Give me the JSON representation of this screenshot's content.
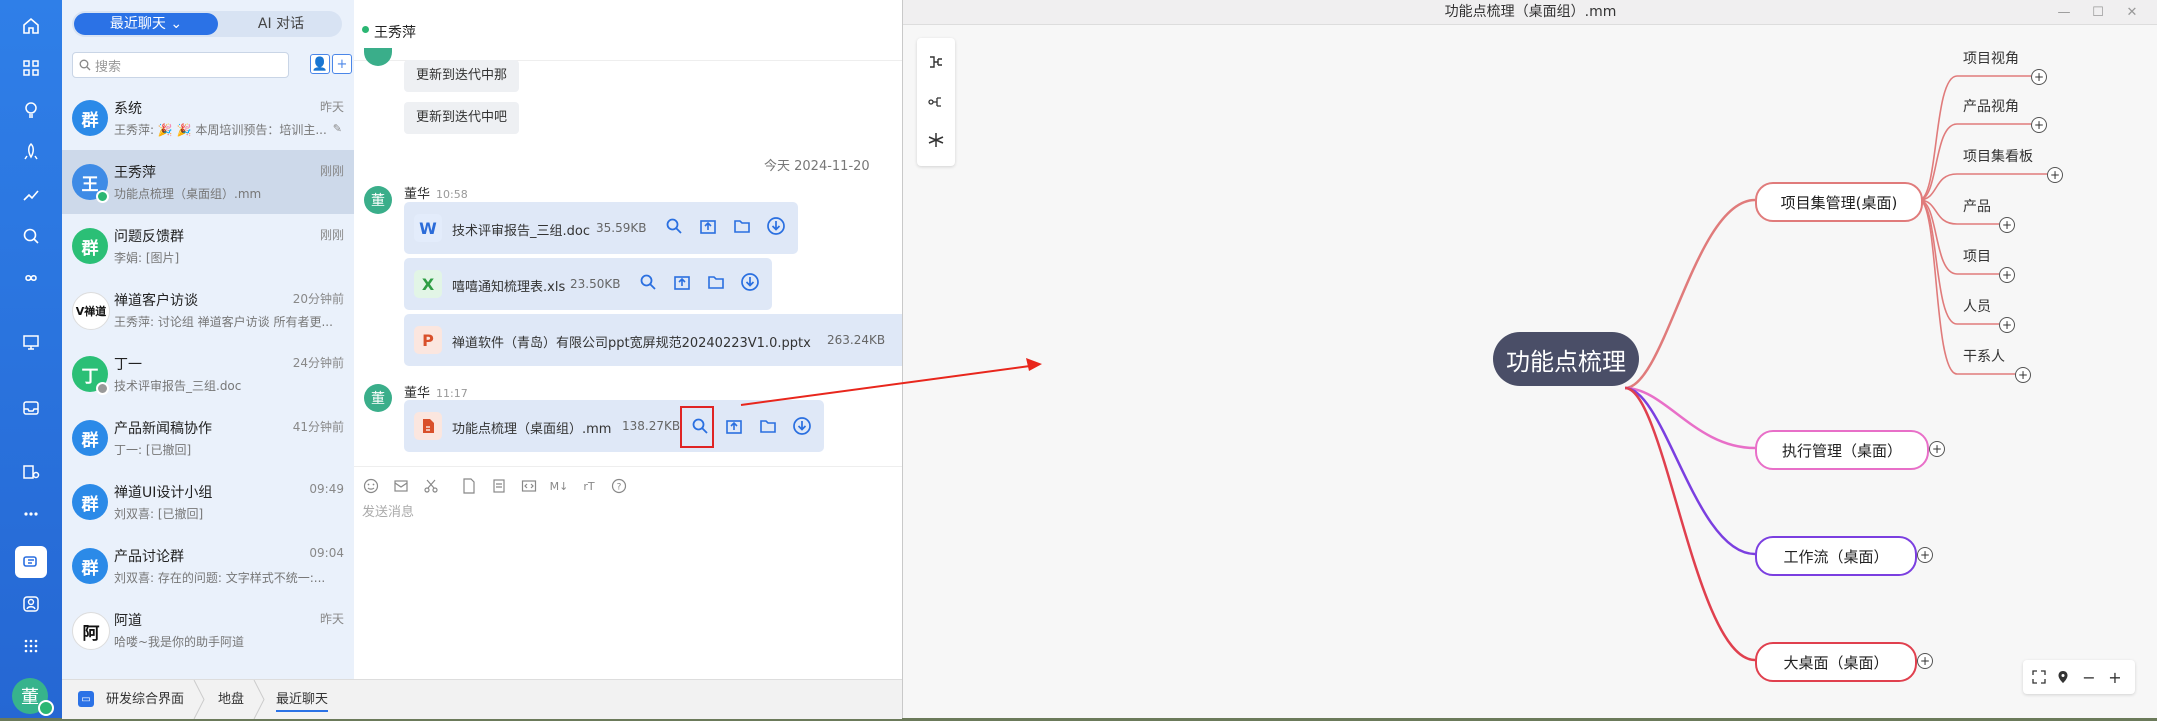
{
  "sidebar_tabs": {
    "recent": "最近聊天",
    "ai": "AI 对话"
  },
  "search": {
    "placeholder": "搜索"
  },
  "conversations": [
    {
      "avatar": "群",
      "name": "系统",
      "time": "昨天",
      "preview": "王秀萍: 🎉 🎉 本周培训预告：培训主...",
      "color": "#2b8ae8"
    },
    {
      "avatar": "王",
      "name": "王秀萍",
      "time": "刚刚",
      "preview": "功能点梳理（桌面组）.mm",
      "color": "#3e8be6"
    },
    {
      "avatar": "群",
      "name": "问题反馈群",
      "time": "刚刚",
      "preview": "李娟: [图片]",
      "color": "#2bbf76"
    },
    {
      "avatar": "V禅道",
      "name": "禅道客户访谈",
      "time": "20分钟前",
      "preview": "王秀萍: 讨论组 禅道客户访谈 所有者更...",
      "color": "#ffffff"
    },
    {
      "avatar": "丁",
      "name": "丁一",
      "time": "24分钟前",
      "preview": "技术评审报告_三组.doc",
      "color": "#2bbf76"
    },
    {
      "avatar": "群",
      "name": "产品新闻稿协作",
      "time": "41分钟前",
      "preview": "丁一: [已撤回]",
      "color": "#2b8ae8"
    },
    {
      "avatar": "群",
      "name": "禅道UI设计小组",
      "time": "09:49",
      "preview": "刘双喜: [已撤回]",
      "color": "#2b8ae8"
    },
    {
      "avatar": "群",
      "name": "产品讨论群",
      "time": "09:04",
      "preview": "刘双喜: 存在的问题:  文字样式不统一:...",
      "color": "#2b8ae8"
    },
    {
      "avatar": "阿",
      "name": "阿道",
      "time": "昨天",
      "preview": "哈喽~我是你的助手阿道",
      "color": "#ffffff"
    }
  ],
  "rail_avatar": "董",
  "bottom_crumbs": [
    "研发综合界面",
    "地盘",
    "最近聊天"
  ],
  "chat": {
    "contact": "王秀萍",
    "messages_top": [
      "更新到迭代中那",
      "更新到迭代中吧"
    ],
    "date_divider": "今天 2024-11-20",
    "group1": {
      "avatar": "董",
      "sender": "董华",
      "time": "10:58"
    },
    "files1": [
      {
        "icon": "W",
        "name": "技术评审报告_三组.doc",
        "size": "35.59KB",
        "icon_color": "#2b6cd9",
        "icon_bg": "#e3ecfb"
      },
      {
        "icon": "X",
        "name": "嘻嘻通知梳理表.xls",
        "size": "23.50KB",
        "icon_color": "#2f9e44",
        "icon_bg": "#e2f5e6"
      },
      {
        "icon": "P",
        "name": "禅道软件（青岛）有限公司ppt宽屏规范20240223V1.0.pptx",
        "size": "263.24KB",
        "icon_color": "#d9502b",
        "icon_bg": "#fbe6df"
      }
    ],
    "group2": {
      "avatar": "董",
      "sender": "董华",
      "time": "11:17"
    },
    "file2": {
      "icon": "▦",
      "name": "功能点梳理（桌面组）.mm",
      "size": "138.27KB",
      "icon_color": "#d9502b",
      "icon_bg": "#fbe6df"
    },
    "composer_tools": [
      "M↓",
      "rT"
    ],
    "composer_placeholder": "发送消息"
  },
  "mindmap": {
    "window_title": "功能点梳理（桌面组）.mm",
    "root": "功能点梳理",
    "branches": [
      {
        "label": "项目集管理(桌面)",
        "color": "#e07b7b"
      },
      {
        "label": "执行管理（桌面）",
        "color": "#e86fc8"
      },
      {
        "label": "工作流（桌面）",
        "color": "#7b3fe0"
      },
      {
        "label": "大桌面（桌面）",
        "color": "#e0404e"
      }
    ],
    "leaves": [
      "项目视角",
      "产品视角",
      "项目集看板",
      "产品",
      "项目",
      "人员",
      "干系人"
    ]
  }
}
